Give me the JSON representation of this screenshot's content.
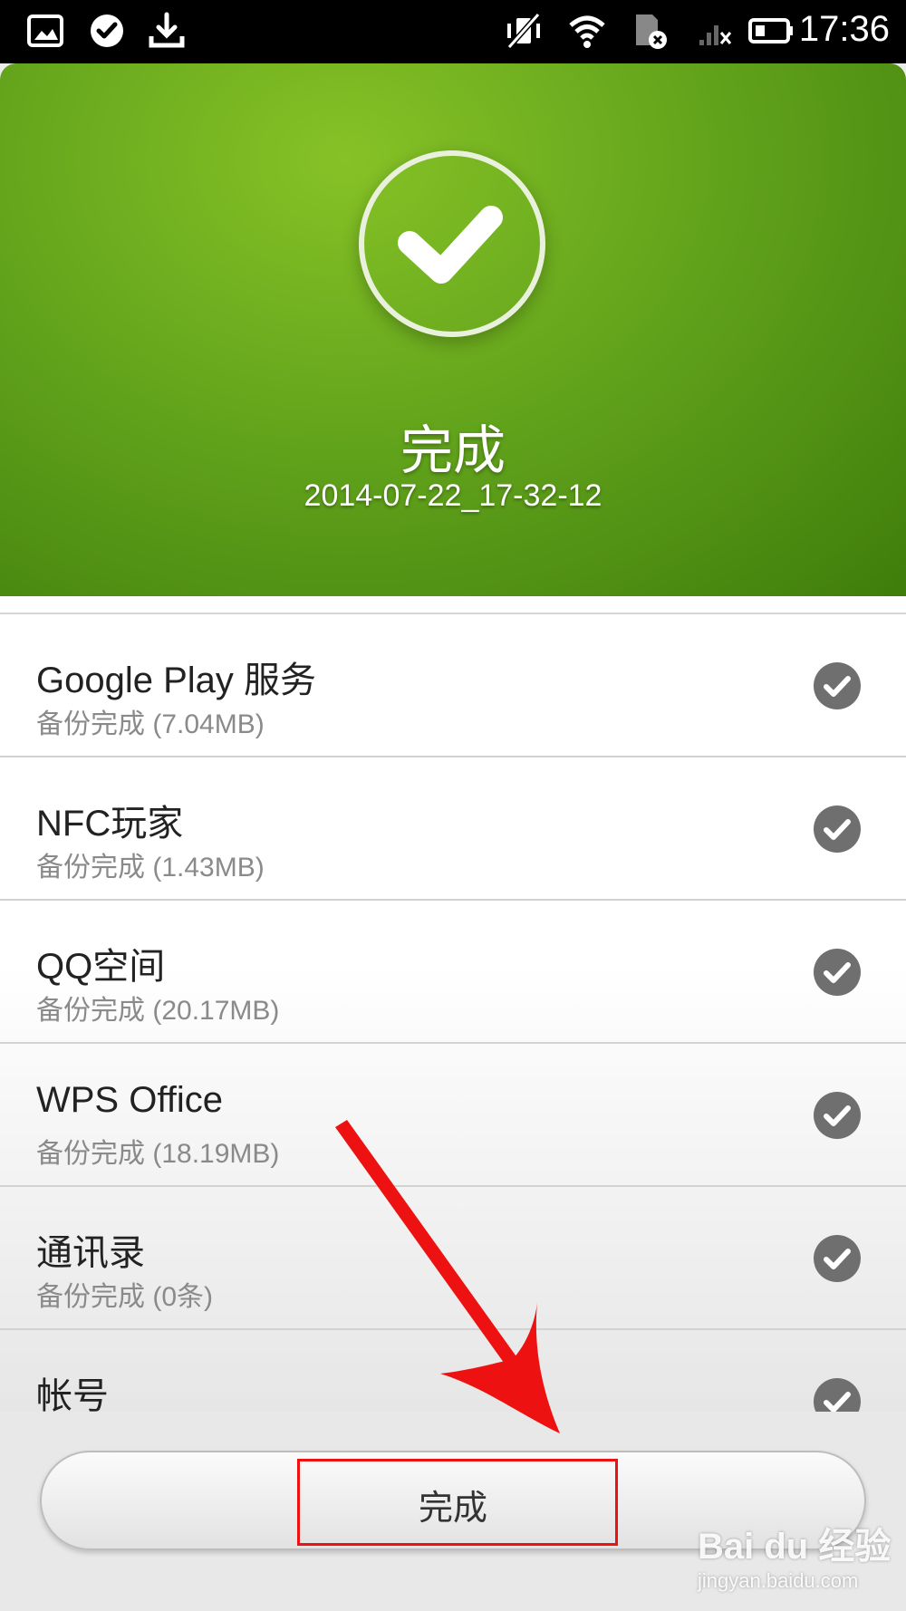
{
  "status_bar": {
    "time": "17:36",
    "left_icons": [
      "gallery-icon",
      "check-circle-icon",
      "download-icon"
    ],
    "right_icons": [
      "vibrate-off-icon",
      "wifi-icon",
      "sim-error-icon",
      "signal-none-icon",
      "battery-icon"
    ]
  },
  "hero": {
    "title": "完成",
    "subtitle": "2014-07-22_17-32-12",
    "icon": "check-circle-icon"
  },
  "backup_items": [
    {
      "name": "Google Play 服务",
      "status": "备份完成 (7.04MB)"
    },
    {
      "name": "NFC玩家",
      "status": "备份完成 (1.43MB)"
    },
    {
      "name": "QQ空间",
      "status": "备份完成 (20.17MB)"
    },
    {
      "name": "WPS Office",
      "status": "备份完成 (18.19MB)"
    },
    {
      "name": "通讯录",
      "status": "备份完成 (0条)"
    },
    {
      "name": "帐号",
      "status": ""
    }
  ],
  "bottom": {
    "done_label": "完成"
  },
  "annotation": {
    "color": "#ee1111"
  },
  "watermark": {
    "brand": "Bai du 经验",
    "url": "jingyan.baidu.com"
  }
}
